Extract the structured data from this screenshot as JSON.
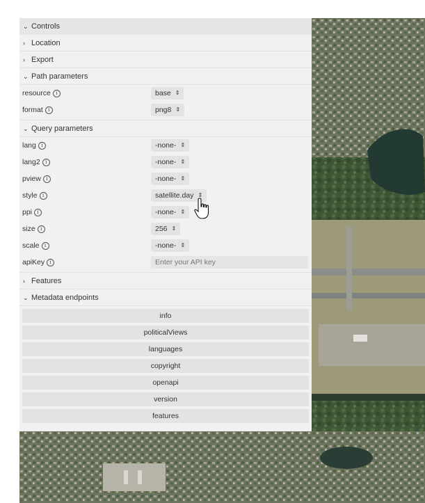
{
  "sections": {
    "controls": "Controls",
    "location": "Location",
    "export": "Export",
    "path_parameters": "Path parameters",
    "query_parameters": "Query parameters",
    "features": "Features",
    "metadata_endpoints": "Metadata endpoints"
  },
  "path_params": [
    {
      "label": "resource",
      "value": "base"
    },
    {
      "label": "format",
      "value": "png8"
    }
  ],
  "query_params": [
    {
      "label": "lang",
      "value": "-none-"
    },
    {
      "label": "lang2",
      "value": "-none-"
    },
    {
      "label": "pview",
      "value": "-none-"
    },
    {
      "label": "style",
      "value": "satellite.day"
    },
    {
      "label": "ppi",
      "value": "-none-"
    },
    {
      "label": "size",
      "value": "256"
    },
    {
      "label": "scale",
      "value": "-none-"
    },
    {
      "label": "apiKey",
      "placeholder": "Enter your API key"
    }
  ],
  "metadata_buttons": [
    "info",
    "politicalViews",
    "languages",
    "copyright",
    "openapi",
    "version",
    "features"
  ],
  "icons": {
    "expanded": "chevron-down-icon",
    "collapsed": "chevron-right-icon",
    "info": "info-icon",
    "select": "updown-arrow-icon",
    "cursor": "hand-pointer-icon"
  }
}
